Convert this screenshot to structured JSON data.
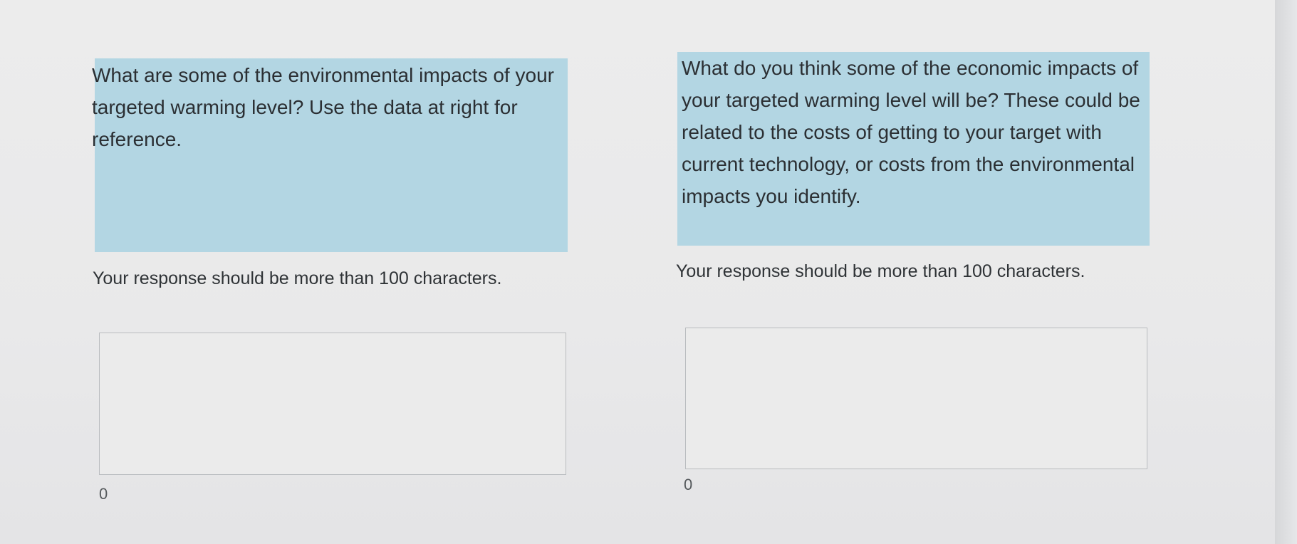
{
  "questions": [
    {
      "text": "What are some of the environmental impacts of your targeted warming level? Use the data at right for reference.",
      "hint": "Your response should be more than 100 characters.",
      "response_value": "",
      "char_count": "0"
    },
    {
      "text": "What do you think some of the economic impacts of your targeted warming level will be? These could be related to the costs of getting to your target with current technology, or costs from the environmental impacts you identify.",
      "hint": "Your response should be more than 100 characters.",
      "response_value": "",
      "char_count": "0"
    }
  ],
  "colors": {
    "question_background": "#b3d6e3",
    "page_background": "#ececec",
    "text": "#2b2f33",
    "textarea_border": "#b9bcbf"
  }
}
